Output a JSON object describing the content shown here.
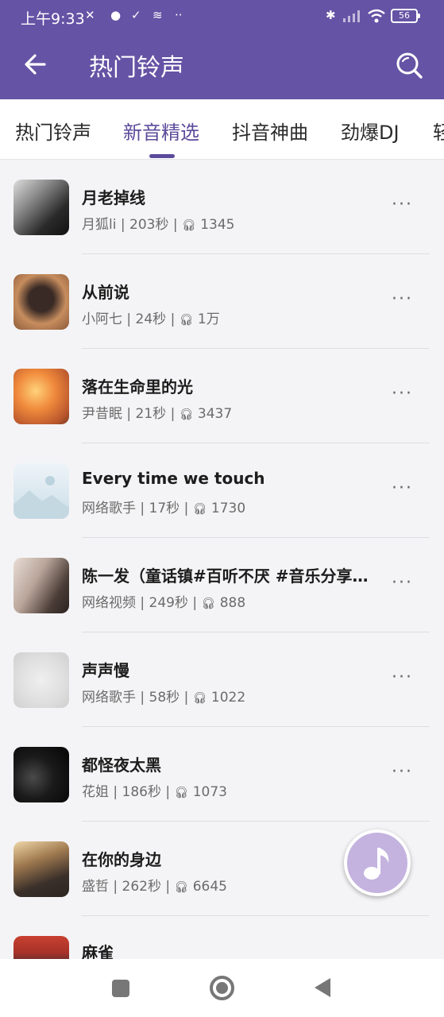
{
  "status_bar": {
    "time": "上午9:33",
    "battery": "56"
  },
  "header": {
    "title": "热门铃声"
  },
  "tabs": [
    {
      "label": "热门铃声"
    },
    {
      "label": "新音精选"
    },
    {
      "label": "抖音神曲"
    },
    {
      "label": "劲爆DJ"
    },
    {
      "label": "轻"
    }
  ],
  "songs": [
    {
      "title": "月老掉线",
      "artist": "月狐li",
      "duration": "203秒",
      "plays": "1345"
    },
    {
      "title": "从前说",
      "artist": "小阿七",
      "duration": "24秒",
      "plays": "1万"
    },
    {
      "title": "落在生命里的光",
      "artist": "尹昔眠",
      "duration": "21秒",
      "plays": "3437"
    },
    {
      "title": "Every time we touch",
      "artist": "网络歌手",
      "duration": "17秒",
      "plays": "1730"
    },
    {
      "title": "陈一发（童话镇#百听不厌 #音乐分享…",
      "artist": "网络视频",
      "duration": "249秒",
      "plays": "888"
    },
    {
      "title": "声声慢",
      "artist": "网络歌手",
      "duration": "58秒",
      "plays": "1022"
    },
    {
      "title": "都怪夜太黑",
      "artist": "花姐",
      "duration": "186秒",
      "plays": "1073"
    },
    {
      "title": "在你的身边",
      "artist": "盛哲",
      "duration": "262秒",
      "plays": "6645"
    },
    {
      "title": "麻雀",
      "artist": "",
      "duration": "",
      "plays": ""
    }
  ],
  "colors": {
    "brand": "#6553a5",
    "tab_active": "#5c4b9b",
    "fab": "#c4b3df"
  }
}
